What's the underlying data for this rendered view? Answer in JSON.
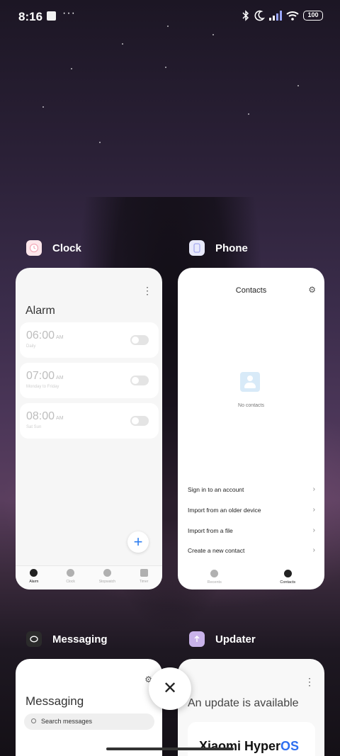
{
  "status_bar": {
    "time": "8:16",
    "dots": "···",
    "battery": "100",
    "icons": [
      "bluetooth-icon",
      "moon-icon",
      "signal-icon",
      "wifi-icon",
      "battery-icon"
    ]
  },
  "apps": [
    {
      "name": "Clock",
      "icon": "clock-app-icon",
      "screen": {
        "title": "Alarm",
        "alarms": [
          {
            "time": "06:00",
            "ampm": "AM",
            "repeat": "Daily",
            "enabled": false
          },
          {
            "time": "07:00",
            "ampm": "AM",
            "repeat": "Monday to Friday",
            "enabled": false
          },
          {
            "time": "08:00",
            "ampm": "AM",
            "repeat": "Sat Sun",
            "enabled": false
          }
        ],
        "fab": "+",
        "tabs": [
          "Alarm",
          "Clock",
          "Stopwatch",
          "Timer"
        ],
        "active_tab": "Alarm"
      }
    },
    {
      "name": "Phone",
      "icon": "phone-app-icon",
      "screen": {
        "title": "Contacts",
        "empty_text": "No contacts",
        "actions": [
          "Sign in to an account",
          "Import from an older device",
          "Import from a file",
          "Create a new contact"
        ],
        "tabs": [
          "Recents",
          "Contacts"
        ],
        "active_tab": "Contacts"
      }
    },
    {
      "name": "Messaging",
      "icon": "messaging-app-icon",
      "screen": {
        "title": "Messaging",
        "search_placeholder": "Search messages"
      }
    },
    {
      "name": "Updater",
      "icon": "updater-app-icon",
      "screen": {
        "title": "An update is available",
        "brand": "Xiaomi Hyper",
        "brand_suffix": "OS"
      }
    }
  ],
  "close_label": "✕",
  "colors": {
    "accent_blue": "#2e7ef0",
    "card_bg": "#f6f6f6"
  }
}
